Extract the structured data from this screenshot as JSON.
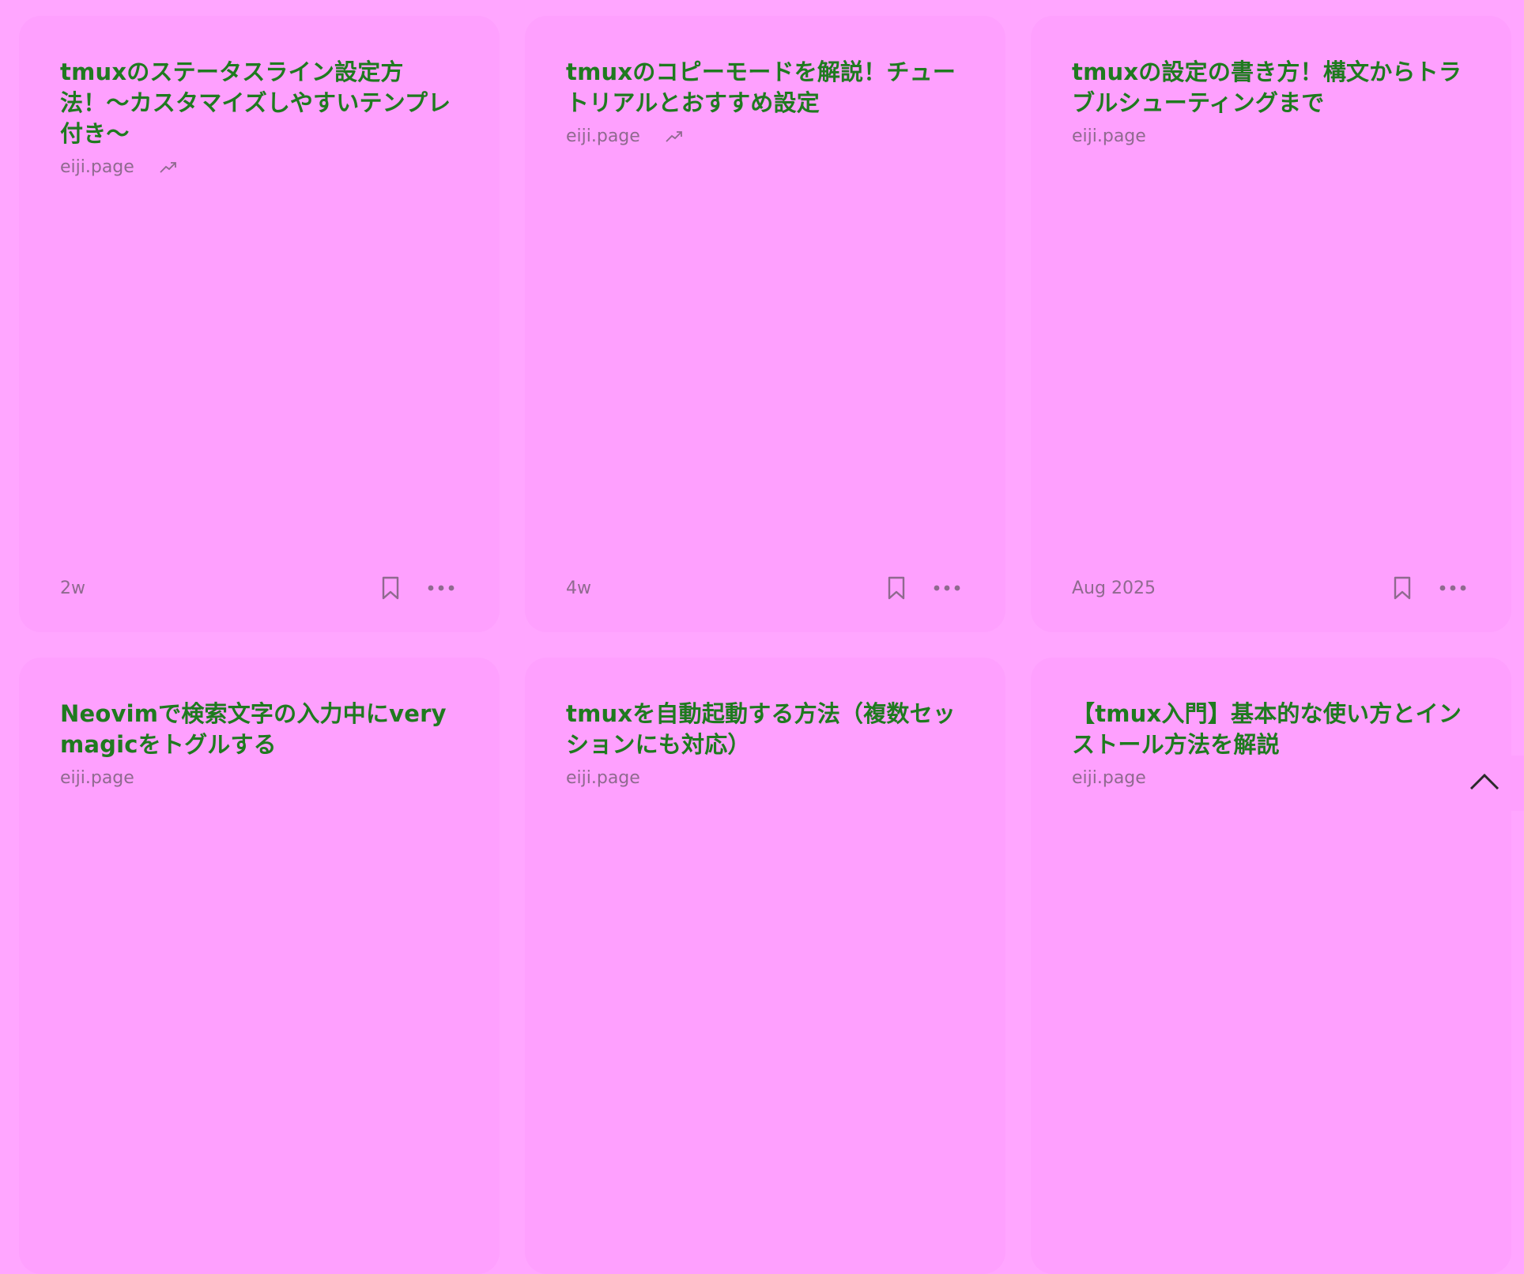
{
  "colors": {
    "page_bg": "#ffa6ff",
    "card_bg": "#fea0fe",
    "title": "#1f7a1f",
    "muted": "#8f6a8f"
  },
  "cards": [
    {
      "title": "tmuxのステータスライン設定方法！〜カスタマイズしやすいテンプレ付き〜",
      "source": "eiji.page",
      "trending": true,
      "age": "2w"
    },
    {
      "title": "tmuxのコピーモードを解説！チュートリアルとおすすめ設定",
      "source": "eiji.page",
      "trending": true,
      "age": "4w"
    },
    {
      "title": "tmuxの設定の書き方！構文からトラブルシューティングまで",
      "source": "eiji.page",
      "trending": false,
      "age": "Aug 2025"
    },
    {
      "title": "Neovimで検索文字の入力中にvery magicをトグルする",
      "source": "eiji.page"
    },
    {
      "title": "tmuxを自動起動する方法（複数セッションにも対応）",
      "source": "eiji.page"
    },
    {
      "title": "【tmux入門】基本的な使い方とインストール方法を解説",
      "source": "eiji.page"
    }
  ],
  "icons": {
    "trend": "trending-up-icon",
    "bookmark": "bookmark-icon",
    "more": "more-horizontal-icon",
    "scroll_top": "chevron-up-icon"
  }
}
